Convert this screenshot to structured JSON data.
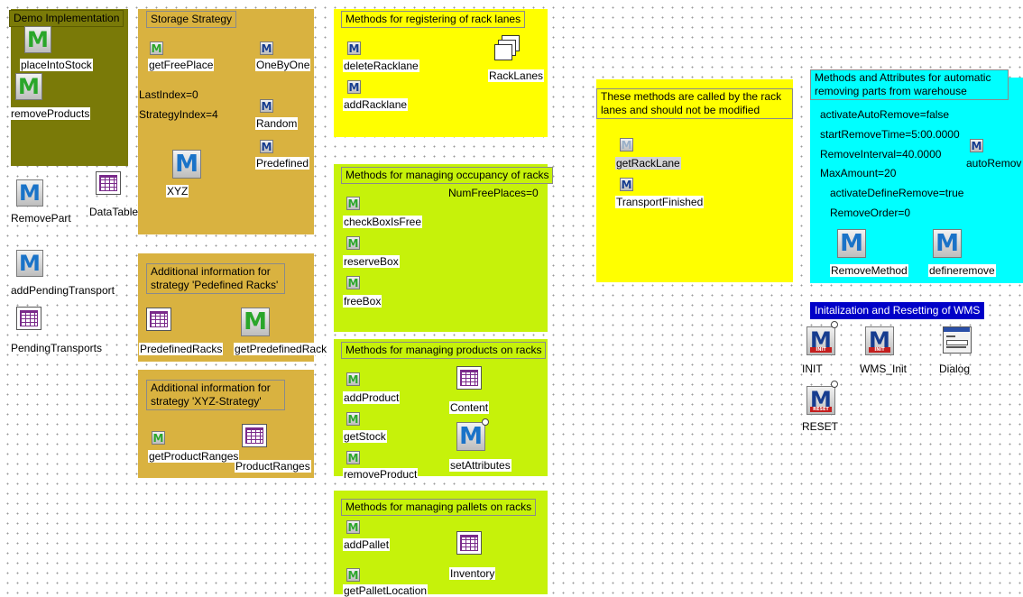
{
  "panels": {
    "demo": {
      "title": "Demo Implementation"
    },
    "storage": {
      "title": "Storage Strategy"
    },
    "registering": {
      "title": "Methods for registering of rack lanes"
    },
    "called": {
      "title": "These methods are called by the rack lanes and should not be modified"
    },
    "occupancy": {
      "title": "Methods for managing occupancy of racks"
    },
    "products": {
      "title": "Methods for managing products on racks"
    },
    "pallets": {
      "title": "Methods for managing pallets on racks"
    },
    "predefined": {
      "title": "Additional information for strategy 'Pedefined Racks'"
    },
    "xyz": {
      "title": "Additional information for strategy 'XYZ-Strategy'"
    },
    "auto": {
      "title": "Methods and Attributes for automatic removing parts from warehouse"
    },
    "init": {
      "title": "Initalization and Resetting of WMS"
    }
  },
  "objects": {
    "placeIntoStock": "placeIntoStock",
    "removeProducts": "removeProducts",
    "RemovePart": "RemovePart",
    "DataTable": "DataTable",
    "addPendingTransport": "addPendingTransport",
    "PendingTransports": "PendingTransports",
    "getFreePlace": "getFreePlace",
    "OneByOne": "OneByOne",
    "Random": "Random",
    "Predefined": "Predefined",
    "XYZ": "XYZ",
    "PredefinedRacks": "PredefinedRacks",
    "getPredefinedRack": "getPredefinedRack",
    "getProductRanges": "getProductRanges",
    "ProductRanges": "ProductRanges",
    "deleteRacklane": "deleteRacklane",
    "addRacklane": "addRacklane",
    "RackLanes": "RackLanes",
    "checkBoxIsFree": "checkBoxIsFree",
    "reserveBox": "reserveBox",
    "freeBox": "freeBox",
    "addProduct": "addProduct",
    "Content": "Content",
    "getStock": "getStock",
    "setAttributes": "setAttributes",
    "removeProduct": "removeProduct",
    "addPallet": "addPallet",
    "Inventory": "Inventory",
    "getPalletLocation": "getPalletLocation",
    "getRackLane": "getRackLane",
    "TransportFinished": "TransportFinished",
    "autoRemove": "autoRemov",
    "RemoveMethod": "RemoveMethod",
    "defineremove": "defineremove",
    "INIT": "INIT",
    "WMS_Init": "WMS_Init",
    "Dialog": "Dialog",
    "RESET": "RESET"
  },
  "attributes": {
    "LastIndex": "LastIndex=0",
    "StrategyIndex": "StrategyIndex=4",
    "NumFreePlaces": "NumFreePlaces=0",
    "activateAutoRemove": "activateAutoRemove=false",
    "startRemoveTime": "startRemoveTime=5:00.0000",
    "RemoveInterval": "RemoveInterval=40.0000",
    "MaxAmount": "MaxAmount=20",
    "activateDefineRemove": "activateDefineRemove=true",
    "RemoveOrder": "RemoveOrder=0"
  },
  "icons": {
    "method_letter": "M",
    "init_strip": "INIT",
    "reset_strip": "RESET"
  },
  "colors": {
    "olive": "#7a7a08",
    "tan": "#d9b240",
    "yellow": "#ffff00",
    "lime": "#c6f20a",
    "cyan": "#00ffff",
    "navy": "#0000c8"
  }
}
